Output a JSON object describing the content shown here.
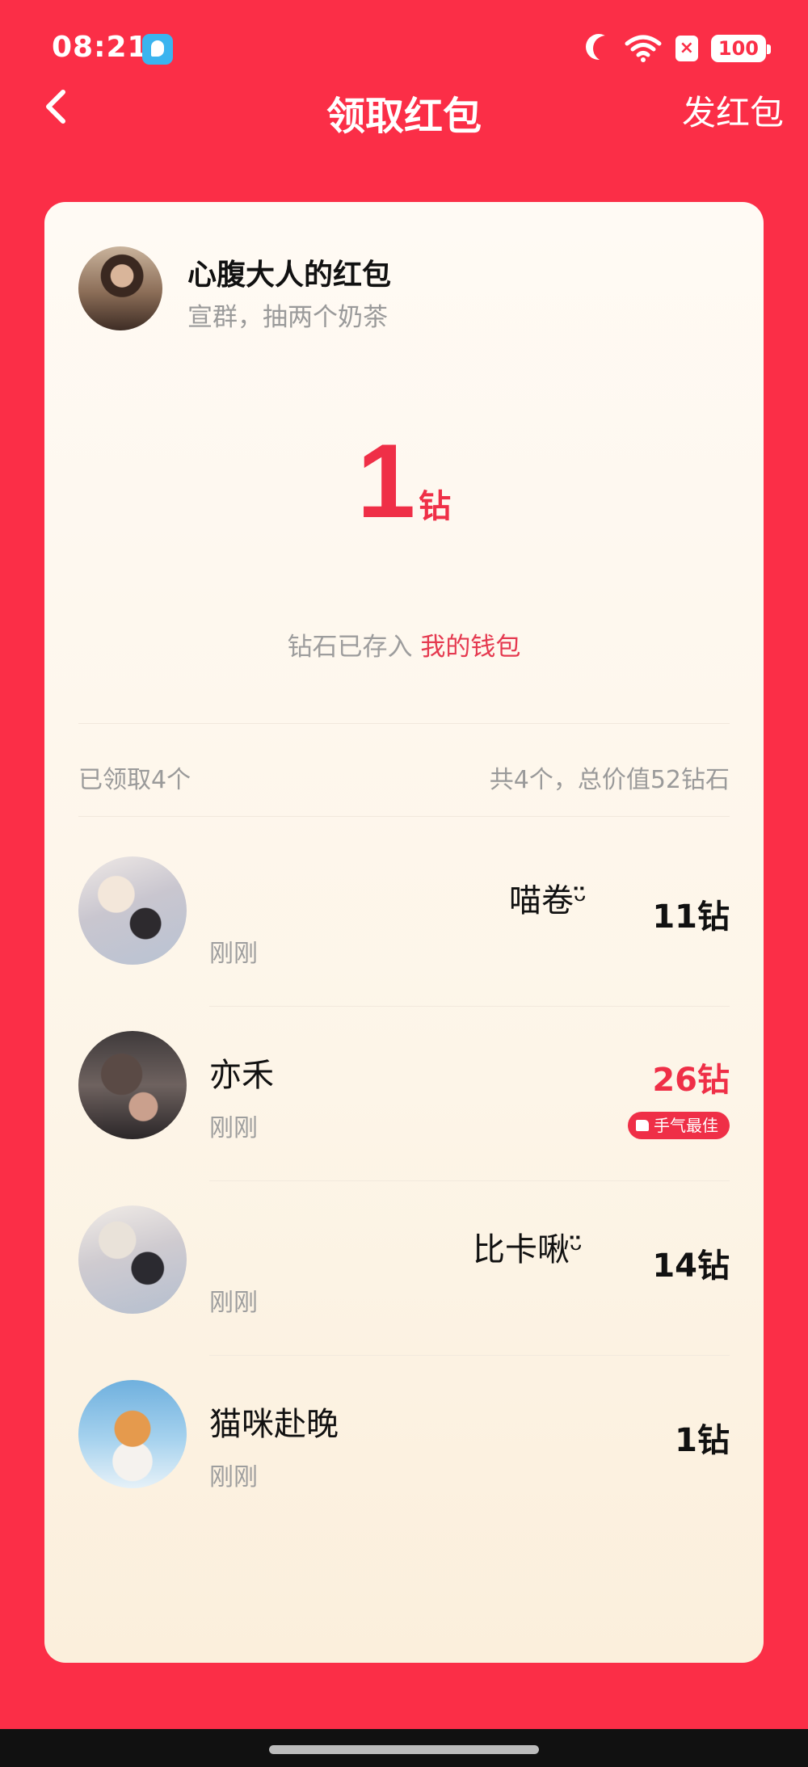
{
  "status_bar": {
    "time": "08:21",
    "battery": "100",
    "sim_status": "×",
    "icons": [
      "app-badge-icon",
      "moon-icon",
      "wifi-icon",
      "sim-x-icon",
      "battery-icon"
    ]
  },
  "nav": {
    "back_icon": "chevron-left-icon",
    "title": "领取红包",
    "send_label": "发红包"
  },
  "sender": {
    "name": "心腹大人的红包",
    "message": "宣群，抽两个奶茶"
  },
  "received": {
    "amount": "1",
    "unit": "钻",
    "wallet_prefix": "钻石已存入",
    "wallet_link": "我的钱包"
  },
  "summary": {
    "claimed": "已领取4个",
    "total": "共4个，总价值52钻石"
  },
  "records": [
    {
      "name": "喵卷ᵕ̈",
      "time": "刚刚",
      "amount": "11钻",
      "best": false
    },
    {
      "name": "亦禾",
      "time": "刚刚",
      "amount": "26钻",
      "best": true,
      "badge": "手气最佳"
    },
    {
      "name": "比卡啾ᵕ̈",
      "time": "刚刚",
      "amount": "14钻",
      "best": false
    },
    {
      "name": "猫咪赴晚",
      "time": "刚刚",
      "amount": "1钻",
      "best": false
    }
  ],
  "colors": {
    "background": "#fb2e47",
    "accent": "#ef2f47",
    "card": "#fffaf4"
  }
}
